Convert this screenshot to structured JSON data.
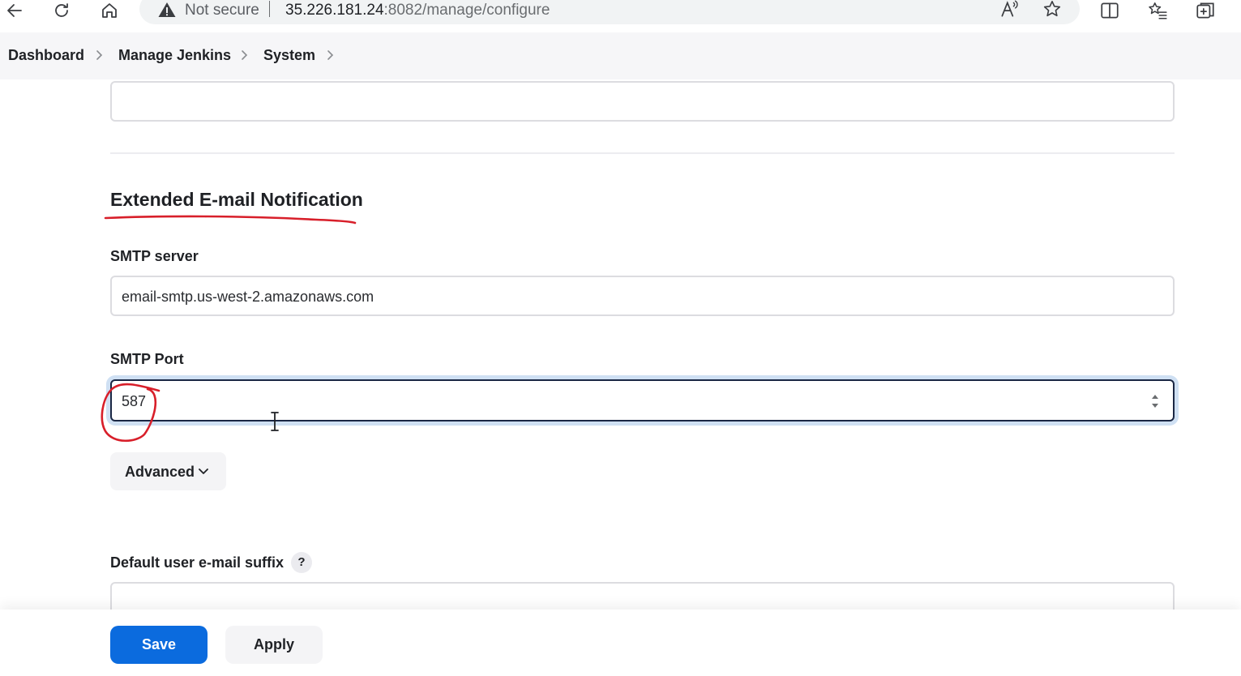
{
  "browser": {
    "not_secure_label": "Not secure",
    "url_host": "35.226.181.24",
    "url_rest": ":8082/manage/configure",
    "icons": [
      "back-arrow-icon",
      "reload-icon",
      "home-icon",
      "warning-icon",
      "read-aloud-icon",
      "favorite-star-icon",
      "split-screen-icon",
      "favorites-icon",
      "collections-icon"
    ]
  },
  "breadcrumb": {
    "items": [
      "Dashboard",
      "Manage Jenkins",
      "System"
    ]
  },
  "section": {
    "title": "Extended E-mail Notification"
  },
  "smtp_server": {
    "label": "SMTP server",
    "value": "email-smtp.us-west-2.amazonaws.com"
  },
  "smtp_port": {
    "label": "SMTP Port",
    "value": "587"
  },
  "advanced": {
    "label": "Advanced"
  },
  "default_suffix": {
    "label": "Default user e-mail suffix",
    "help": "?"
  },
  "actions": {
    "save_label": "Save",
    "apply_label": "Apply"
  },
  "colors": {
    "primary": "#0b6bde",
    "annotation": "#d81f2a",
    "focus_border": "#1a2744",
    "focus_ring": "#cfe0f3"
  }
}
